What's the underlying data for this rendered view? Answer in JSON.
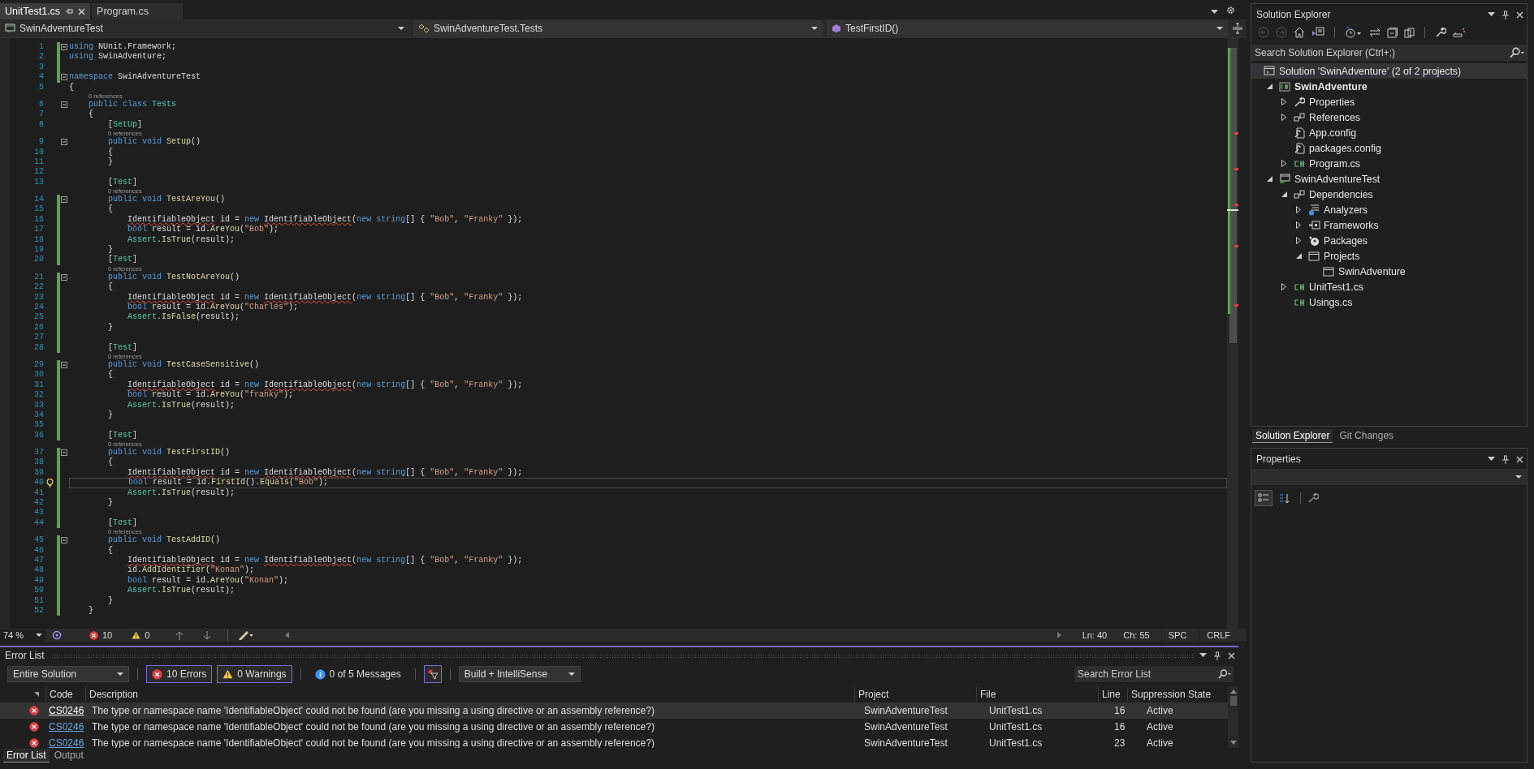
{
  "editor_tabs": [
    {
      "label": "UnitTest1.cs",
      "selected": true
    },
    {
      "label": "Program.cs",
      "selected": false
    }
  ],
  "navigation_bar": {
    "project": "SwinAdventureTest",
    "class": "SwinAdventureTest.Tests",
    "member": "TestFirstID()"
  },
  "code_lines": [
    {
      "number": "1",
      "fold": true,
      "changed": true,
      "current": false,
      "tokens": [
        {
          "kind": "keyword",
          "text": "using"
        },
        {
          "kind": "text",
          "text": " NUnit.Framework;"
        }
      ]
    },
    {
      "number": "2",
      "fold": false,
      "changed": true,
      "current": false,
      "tokens": [
        {
          "kind": "keyword",
          "text": "using"
        },
        {
          "kind": "text",
          "text": " SwinAdventure;"
        }
      ]
    },
    {
      "number": "3",
      "fold": false,
      "changed": true,
      "current": false
    },
    {
      "number": "4",
      "fold": true,
      "changed": true,
      "current": false,
      "tokens": [
        {
          "kind": "keyword",
          "text": "namespace"
        },
        {
          "kind": "text",
          "text": " SwinAdventureTest"
        }
      ]
    },
    {
      "number": "5",
      "fold": false,
      "changed": false,
      "current": false,
      "tokens": [
        {
          "kind": "text",
          "text": "{"
        }
      ]
    },
    {
      "number": "6",
      "fold": true,
      "changed": false,
      "current": false,
      "codelens": "0 references",
      "tokens": [
        {
          "kind": "keyword",
          "text": "    public class "
        },
        {
          "kind": "type",
          "text": "Tests"
        }
      ]
    },
    {
      "number": "7",
      "fold": false,
      "changed": false,
      "current": false,
      "tokens": [
        {
          "kind": "text",
          "text": "    {"
        }
      ]
    },
    {
      "number": "8",
      "fold": false,
      "changed": false,
      "current": false,
      "tokens": [
        {
          "kind": "text",
          "text": "        ["
        },
        {
          "kind": "type",
          "text": "SetUp"
        },
        {
          "kind": "text",
          "text": "]"
        }
      ]
    },
    {
      "number": "9",
      "fold": true,
      "changed": false,
      "current": false,
      "codelens": "0 references",
      "tokens": [
        {
          "kind": "keyword",
          "text": "        public void "
        },
        {
          "kind": "method",
          "text": "Setup"
        },
        {
          "kind": "text",
          "text": "()"
        }
      ]
    },
    {
      "number": "10",
      "fold": false,
      "changed": false,
      "current": false,
      "tokens": [
        {
          "kind": "text",
          "text": "        {"
        }
      ]
    },
    {
      "number": "11",
      "fold": false,
      "changed": false,
      "current": false,
      "tokens": [
        {
          "kind": "text",
          "text": "        }"
        }
      ]
    },
    {
      "number": "12",
      "fold": false,
      "changed": false,
      "current": false
    },
    {
      "number": "13",
      "fold": false,
      "changed": false,
      "current": false,
      "tokens": [
        {
          "kind": "text",
          "text": "        ["
        },
        {
          "kind": "type",
          "text": "Test"
        },
        {
          "kind": "text",
          "text": "]"
        }
      ]
    },
    {
      "number": "14",
      "fold": true,
      "changed": true,
      "current": false,
      "codelens": "0 references",
      "tokens": [
        {
          "kind": "keyword",
          "text": "        public void "
        },
        {
          "kind": "method",
          "text": "TestAreYou"
        },
        {
          "kind": "text",
          "text": "()"
        }
      ]
    },
    {
      "number": "15",
      "fold": false,
      "changed": true,
      "current": false,
      "tokens": [
        {
          "kind": "text",
          "text": "        {"
        }
      ]
    },
    {
      "number": "16",
      "fold": false,
      "changed": true,
      "current": false,
      "tokens": [
        {
          "kind": "error_type",
          "text": "            IdentifiableObject"
        },
        {
          "kind": "text",
          "text": " id = "
        },
        {
          "kind": "keyword",
          "text": "new "
        },
        {
          "kind": "error_type",
          "text": "IdentifiableObject"
        },
        {
          "kind": "text",
          "text": "("
        },
        {
          "kind": "keyword",
          "text": "new string"
        },
        {
          "kind": "text",
          "text": "[] { "
        },
        {
          "kind": "string",
          "text": "\"Bob\""
        },
        {
          "kind": "text",
          "text": ", "
        },
        {
          "kind": "string",
          "text": "\"Franky\""
        },
        {
          "kind": "text",
          "text": " });"
        }
      ]
    },
    {
      "number": "17",
      "fold": false,
      "changed": true,
      "current": false,
      "tokens": [
        {
          "kind": "keyword",
          "text": "            bool"
        },
        {
          "kind": "text",
          "text": " result = id."
        },
        {
          "kind": "method",
          "text": "AreYou"
        },
        {
          "kind": "text",
          "text": "("
        },
        {
          "kind": "string",
          "text": "\"Bob\""
        },
        {
          "kind": "text",
          "text": ");"
        }
      ]
    },
    {
      "number": "18",
      "fold": false,
      "changed": true,
      "current": false,
      "tokens": [
        {
          "kind": "type",
          "text": "            Assert"
        },
        {
          "kind": "text",
          "text": "."
        },
        {
          "kind": "method",
          "text": "IsTrue"
        },
        {
          "kind": "text",
          "text": "(result);"
        }
      ]
    },
    {
      "number": "19",
      "fold": false,
      "changed": true,
      "current": false,
      "tokens": [
        {
          "kind": "text",
          "text": "        }"
        }
      ]
    },
    {
      "number": "20",
      "fold": false,
      "changed": true,
      "current": false,
      "tokens": [
        {
          "kind": "text",
          "text": "        ["
        },
        {
          "kind": "type",
          "text": "Test"
        },
        {
          "kind": "text",
          "text": "]"
        }
      ]
    },
    {
      "number": "21",
      "fold": true,
      "changed": true,
      "current": false,
      "codelens": "0 references",
      "tokens": [
        {
          "kind": "keyword",
          "text": "        public void "
        },
        {
          "kind": "method",
          "text": "TestNotAreYou"
        },
        {
          "kind": "text",
          "text": "()"
        }
      ]
    },
    {
      "number": "22",
      "fold": false,
      "changed": true,
      "current": false,
      "tokens": [
        {
          "kind": "text",
          "text": "        {"
        }
      ]
    },
    {
      "number": "23",
      "fold": false,
      "changed": true,
      "current": false,
      "tokens": [
        {
          "kind": "error_type",
          "text": "            IdentifiableObject"
        },
        {
          "kind": "text",
          "text": " id = "
        },
        {
          "kind": "keyword",
          "text": "new "
        },
        {
          "kind": "error_type",
          "text": "IdentifiableObject"
        },
        {
          "kind": "text",
          "text": "("
        },
        {
          "kind": "keyword",
          "text": "new string"
        },
        {
          "kind": "text",
          "text": "[] { "
        },
        {
          "kind": "string",
          "text": "\"Bob\""
        },
        {
          "kind": "text",
          "text": ", "
        },
        {
          "kind": "string",
          "text": "\"Franky\""
        },
        {
          "kind": "text",
          "text": " });"
        }
      ]
    },
    {
      "number": "24",
      "fold": false,
      "changed": true,
      "current": false,
      "tokens": [
        {
          "kind": "keyword",
          "text": "            bool"
        },
        {
          "kind": "text",
          "text": " result = id."
        },
        {
          "kind": "method",
          "text": "AreYou"
        },
        {
          "kind": "text",
          "text": "("
        },
        {
          "kind": "string",
          "text": "\"Charles\""
        },
        {
          "kind": "text",
          "text": ");"
        }
      ]
    },
    {
      "number": "25",
      "fold": false,
      "changed": true,
      "current": false,
      "tokens": [
        {
          "kind": "type",
          "text": "            Assert"
        },
        {
          "kind": "text",
          "text": "."
        },
        {
          "kind": "method",
          "text": "IsFalse"
        },
        {
          "kind": "text",
          "text": "(result);"
        }
      ]
    },
    {
      "number": "26",
      "fold": false,
      "changed": true,
      "current": false,
      "tokens": [
        {
          "kind": "text",
          "text": "        }"
        }
      ]
    },
    {
      "number": "27",
      "fold": false,
      "changed": true,
      "current": false
    },
    {
      "number": "28",
      "fold": false,
      "changed": true,
      "current": false,
      "tokens": [
        {
          "kind": "text",
          "text": "        ["
        },
        {
          "kind": "type",
          "text": "Test"
        },
        {
          "kind": "text",
          "text": "]"
        }
      ]
    },
    {
      "number": "29",
      "fold": true,
      "changed": true,
      "current": false,
      "codelens": "0 references",
      "tokens": [
        {
          "kind": "keyword",
          "text": "        public void "
        },
        {
          "kind": "method",
          "text": "TestCaseSensitive"
        },
        {
          "kind": "text",
          "text": "()"
        }
      ]
    },
    {
      "number": "30",
      "fold": false,
      "changed": true,
      "current": false,
      "tokens": [
        {
          "kind": "text",
          "text": "        {"
        }
      ]
    },
    {
      "number": "31",
      "fold": false,
      "changed": true,
      "current": false,
      "tokens": [
        {
          "kind": "error_type",
          "text": "            IdentifiableObject"
        },
        {
          "kind": "text",
          "text": " id = "
        },
        {
          "kind": "keyword",
          "text": "new "
        },
        {
          "kind": "error_type",
          "text": "IdentifiableObject"
        },
        {
          "kind": "text",
          "text": "("
        },
        {
          "kind": "keyword",
          "text": "new string"
        },
        {
          "kind": "text",
          "text": "[] { "
        },
        {
          "kind": "string",
          "text": "\"Bob\""
        },
        {
          "kind": "text",
          "text": ", "
        },
        {
          "kind": "string",
          "text": "\"Franky\""
        },
        {
          "kind": "text",
          "text": " });"
        }
      ]
    },
    {
      "number": "32",
      "fold": false,
      "changed": true,
      "current": false,
      "tokens": [
        {
          "kind": "keyword",
          "text": "            bool"
        },
        {
          "kind": "text",
          "text": " result = id."
        },
        {
          "kind": "method",
          "text": "AreYou"
        },
        {
          "kind": "text",
          "text": "("
        },
        {
          "kind": "string",
          "text": "\"franky\""
        },
        {
          "kind": "text",
          "text": ");"
        }
      ]
    },
    {
      "number": "33",
      "fold": false,
      "changed": true,
      "current": false,
      "tokens": [
        {
          "kind": "type",
          "text": "            Assert"
        },
        {
          "kind": "text",
          "text": "."
        },
        {
          "kind": "method",
          "text": "IsTrue"
        },
        {
          "kind": "text",
          "text": "(result);"
        }
      ]
    },
    {
      "number": "34",
      "fold": false,
      "changed": true,
      "current": false,
      "tokens": [
        {
          "kind": "text",
          "text": "        }"
        }
      ]
    },
    {
      "number": "35",
      "fold": false,
      "changed": true,
      "current": false
    },
    {
      "number": "36",
      "fold": false,
      "changed": true,
      "current": false,
      "tokens": [
        {
          "kind": "text",
          "text": "        ["
        },
        {
          "kind": "type",
          "text": "Test"
        },
        {
          "kind": "text",
          "text": "]"
        }
      ]
    },
    {
      "number": "37",
      "fold": true,
      "changed": true,
      "current": false,
      "codelens": "0 references",
      "tokens": [
        {
          "kind": "keyword",
          "text": "        public void "
        },
        {
          "kind": "method",
          "text": "TestFirstID"
        },
        {
          "kind": "text",
          "text": "()"
        }
      ]
    },
    {
      "number": "38",
      "fold": false,
      "changed": true,
      "current": false,
      "tokens": [
        {
          "kind": "text",
          "text": "        {"
        }
      ]
    },
    {
      "number": "39",
      "fold": false,
      "changed": true,
      "current": false,
      "tokens": [
        {
          "kind": "error_type",
          "text": "            IdentifiableObject"
        },
        {
          "kind": "text",
          "text": " id = "
        },
        {
          "kind": "keyword",
          "text": "new "
        },
        {
          "kind": "error_type",
          "text": "IdentifiableObject"
        },
        {
          "kind": "text",
          "text": "("
        },
        {
          "kind": "keyword",
          "text": "new string"
        },
        {
          "kind": "text",
          "text": "[] { "
        },
        {
          "kind": "string",
          "text": "\"Bob\""
        },
        {
          "kind": "text",
          "text": ", "
        },
        {
          "kind": "string",
          "text": "\"Franky\""
        },
        {
          "kind": "text",
          "text": " });"
        }
      ]
    },
    {
      "number": "40",
      "fold": false,
      "changed": true,
      "current": true,
      "tokens": [
        {
          "kind": "keyword",
          "text": "            bool"
        },
        {
          "kind": "text",
          "text": " result = id."
        },
        {
          "kind": "method",
          "text": "FirstId"
        },
        {
          "kind": "text",
          "text": "()."
        },
        {
          "kind": "method",
          "text": "Equals"
        },
        {
          "kind": "text",
          "text": "("
        },
        {
          "kind": "string",
          "text": "\"Bob\""
        },
        {
          "kind": "text",
          "text": ");"
        }
      ]
    },
    {
      "number": "41",
      "fold": false,
      "changed": true,
      "current": false,
      "tokens": [
        {
          "kind": "type",
          "text": "            Assert"
        },
        {
          "kind": "text",
          "text": "."
        },
        {
          "kind": "method",
          "text": "IsTrue"
        },
        {
          "kind": "text",
          "text": "(result);"
        }
      ]
    },
    {
      "number": "42",
      "fold": false,
      "changed": true,
      "current": false,
      "tokens": [
        {
          "kind": "text",
          "text": "        }"
        }
      ]
    },
    {
      "number": "43",
      "fold": false,
      "changed": true,
      "current": false
    },
    {
      "number": "44",
      "fold": false,
      "changed": true,
      "current": false,
      "tokens": [
        {
          "kind": "text",
          "text": "        ["
        },
        {
          "kind": "type",
          "text": "Test"
        },
        {
          "kind": "text",
          "text": "]"
        }
      ]
    },
    {
      "number": "45",
      "fold": true,
      "changed": true,
      "current": false,
      "codelens": "0 references",
      "tokens": [
        {
          "kind": "keyword",
          "text": "        public void "
        },
        {
          "kind": "method",
          "text": "TestAddID"
        },
        {
          "kind": "text",
          "text": "()"
        }
      ]
    },
    {
      "number": "46",
      "fold": false,
      "changed": true,
      "current": false,
      "tokens": [
        {
          "kind": "text",
          "text": "        {"
        }
      ]
    },
    {
      "number": "47",
      "fold": false,
      "changed": true,
      "current": false,
      "tokens": [
        {
          "kind": "error_type",
          "text": "            IdentifiableObject"
        },
        {
          "kind": "text",
          "text": " id = "
        },
        {
          "kind": "keyword",
          "text": "new "
        },
        {
          "kind": "error_type",
          "text": "IdentifiableObject"
        },
        {
          "kind": "text",
          "text": "("
        },
        {
          "kind": "keyword",
          "text": "new string"
        },
        {
          "kind": "text",
          "text": "[] { "
        },
        {
          "kind": "string",
          "text": "\"Bob\""
        },
        {
          "kind": "text",
          "text": ", "
        },
        {
          "kind": "string",
          "text": "\"Franky\""
        },
        {
          "kind": "text",
          "text": " });"
        }
      ]
    },
    {
      "number": "48",
      "fold": false,
      "changed": true,
      "current": false,
      "tokens": [
        {
          "kind": "text",
          "text": "            id."
        },
        {
          "kind": "method",
          "text": "AddIdentifier"
        },
        {
          "kind": "text",
          "text": "("
        },
        {
          "kind": "string",
          "text": "\"Konan\""
        },
        {
          "kind": "text",
          "text": ");"
        }
      ]
    },
    {
      "number": "49",
      "fold": false,
      "changed": true,
      "current": false,
      "tokens": [
        {
          "kind": "keyword",
          "text": "            bool"
        },
        {
          "kind": "text",
          "text": " result = id."
        },
        {
          "kind": "method",
          "text": "AreYou"
        },
        {
          "kind": "text",
          "text": "("
        },
        {
          "kind": "string",
          "text": "\"Konan\""
        },
        {
          "kind": "text",
          "text": ");"
        }
      ]
    },
    {
      "number": "50",
      "fold": false,
      "changed": true,
      "current": false,
      "tokens": [
        {
          "kind": "type",
          "text": "            Assert"
        },
        {
          "kind": "text",
          "text": "."
        },
        {
          "kind": "method",
          "text": "IsTrue"
        },
        {
          "kind": "text",
          "text": "(result);"
        }
      ]
    },
    {
      "number": "51",
      "fold": false,
      "changed": true,
      "current": false,
      "tokens": [
        {
          "kind": "text",
          "text": "        }"
        }
      ]
    },
    {
      "number": "52",
      "fold": false,
      "changed": true,
      "current": false,
      "tokens": [
        {
          "kind": "text",
          "text": "    }"
        }
      ]
    }
  ],
  "status": {
    "zoom": "74 %",
    "errors": "10",
    "warnings": "0",
    "line": "Ln: 40",
    "column": "Ch: 55",
    "indentation": "SPC",
    "line_ending": "CRLF"
  },
  "error_list": {
    "title": "Error List",
    "scope": "Entire Solution",
    "filters": [
      {
        "kind": "error",
        "label": "10 Errors",
        "selected": true
      },
      {
        "kind": "warning",
        "label": "0 Warnings",
        "selected": true
      },
      {
        "kind": "message",
        "label": "0 of 5 Messages",
        "selected": false
      }
    ],
    "source": "Build + IntelliSense",
    "search": {
      "placeholder": "Search Error List"
    },
    "columns": [
      "Code",
      "Description",
      "Project",
      "File",
      "Line",
      "Suppression State"
    ],
    "rows": [
      {
        "selected": true,
        "cells": [
          "CS0246",
          "The type or namespace name 'IdentifiableObject' could not be found (are you missing a using directive or an assembly reference?)",
          "SwinAdventureTest",
          "UnitTest1.cs",
          "16",
          "Active"
        ]
      },
      {
        "selected": false,
        "cells": [
          "CS0246",
          "The type or namespace name 'IdentifiableObject' could not be found (are you missing a using directive or an assembly reference?)",
          "SwinAdventureTest",
          "UnitTest1.cs",
          "16",
          "Active"
        ]
      },
      {
        "selected": false,
        "cells": [
          "CS0246",
          "The type or namespace name 'IdentifiableObject' could not be found (are you missing a using directive or an assembly reference?)",
          "SwinAdventureTest",
          "UnitTest1.cs",
          "23",
          "Active"
        ]
      }
    ],
    "tabs": [
      {
        "label": "Error List",
        "selected": true
      },
      {
        "label": "Output",
        "selected": false
      }
    ]
  },
  "solution_explorer": {
    "title": "Solution Explorer",
    "search": {
      "placeholder": "Search Solution Explorer (Ctrl+;)"
    },
    "solution": {
      "label": "Solution 'SwinAdventure' (2 of 2 projects)",
      "selected": true
    },
    "items": [
      {
        "label": "SwinAdventure",
        "kind": "csharp_project",
        "bold": true,
        "expanded": true,
        "selected": false,
        "children": [
          {
            "label": "Properties",
            "kind": "wrench",
            "expanded": false,
            "selected": false
          },
          {
            "label": "References",
            "kind": "references",
            "expanded": false,
            "selected": false
          },
          {
            "label": "App.config",
            "kind": "config",
            "selected": false
          },
          {
            "label": "packages.config",
            "kind": "config",
            "selected": false
          },
          {
            "label": "Program.cs",
            "kind": "csharp_file",
            "expanded": false,
            "selected": false
          }
        ]
      },
      {
        "label": "SwinAdventureTest",
        "kind": "test_project",
        "bold": false,
        "expanded": true,
        "selected": false,
        "children": [
          {
            "label": "Dependencies",
            "kind": "references",
            "expanded": true,
            "selected": false,
            "children": [
              {
                "label": "Analyzers",
                "kind": "analyzers",
                "expanded": false,
                "selected": false
              },
              {
                "label": "Frameworks",
                "kind": "frameworks",
                "expanded": false,
                "selected": false
              },
              {
                "label": "Packages",
                "kind": "packages",
                "expanded": false,
                "selected": false
              },
              {
                "label": "Projects",
                "kind": "window",
                "expanded": true,
                "selected": false,
                "children": [
                  {
                    "label": "SwinAdventure",
                    "kind": "window",
                    "selected": false
                  }
                ]
              }
            ]
          },
          {
            "label": "UnitTest1.cs",
            "kind": "csharp_file",
            "expanded": false,
            "selected": false
          },
          {
            "label": "Usings.cs",
            "kind": "csharp_file",
            "selected": false
          }
        ]
      }
    ],
    "tabs": [
      {
        "label": "Solution Explorer",
        "selected": true
      },
      {
        "label": "Git Changes",
        "selected": false
      }
    ]
  },
  "properties": {
    "title": "Properties"
  }
}
